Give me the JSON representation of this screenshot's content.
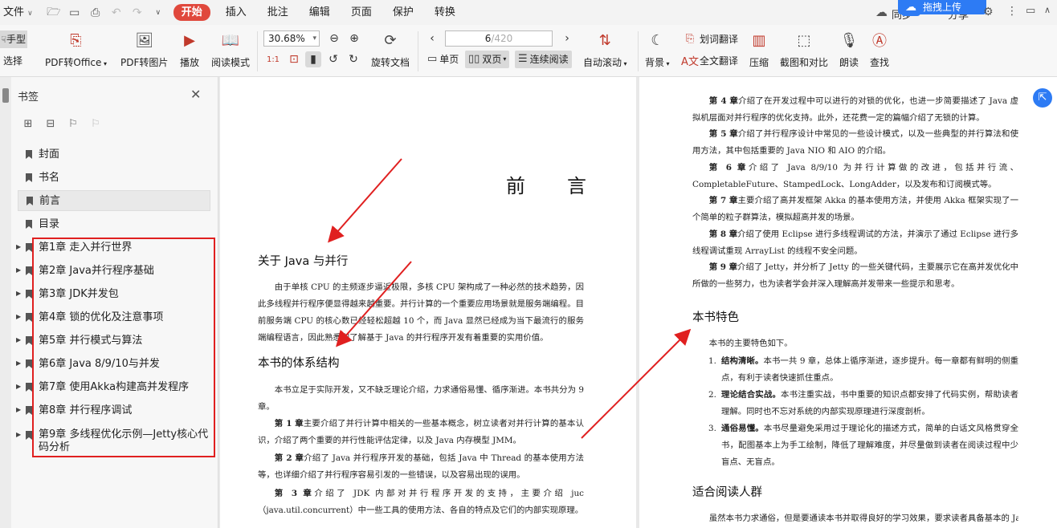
{
  "menubar": {
    "file": "文件",
    "items": [
      "开始",
      "插入",
      "批注",
      "编辑",
      "页面",
      "保护",
      "转换"
    ],
    "sync": "同步",
    "share": "分享",
    "upload": "拖拽上传"
  },
  "ribbon": {
    "hand": "手型",
    "select": "选择",
    "pdf_to_office": "PDF转Office",
    "pdf_to_image": "PDF转图片",
    "play": "播放",
    "read_mode": "阅读模式",
    "zoom": "30.68%",
    "rotate": "旋转文档",
    "page_current": "6",
    "page_total": "/420",
    "single": "单页",
    "double": "双页",
    "continuous": "连续阅读",
    "autoscroll": "自动滚动",
    "background": "背景",
    "word_translate": "划词翻译",
    "full_translate": "全文翻译",
    "compress": "压缩",
    "screenshot_compare": "截图和对比",
    "read_aloud": "朗读",
    "find": "查找"
  },
  "sidebar": {
    "title": "书签",
    "items": [
      "封面",
      "书名",
      "前言",
      "目录",
      "第1章 走入并行世界",
      "第2章 Java并行程序基础",
      "第3章 JDK并发包",
      "第4章 锁的优化及注意事项",
      "第5章 并行模式与算法",
      "第6章 Java 8/9/10与并发",
      "第7章 使用Akka构建高并发程序",
      "第8章 并行程序调试",
      "第9章 多线程优化示例—Jetty核心代码分析"
    ]
  },
  "doc": {
    "left": {
      "heading": "前言",
      "s1_title": "关于 Java 与并行",
      "s1_p": "由于单核 CPU 的主频逐步逼近极限，多核 CPU 架构成了一种必然的技术趋势，因此多线程并行程序便显得越来越重要。并行计算的一个重要应用场景就是服务端编程。目前服务端 CPU 的核心数已经轻松超越 10 个，而 Java 显然已经成为当下最流行的服务端编程语言，因此熟悉和了解基于 Java 的并行程序开发有着重要的实用价值。",
      "s2_title": "本书的体系结构",
      "s2_p": "本书立足于实际开发，又不缺乏理论介绍，力求通俗易懂、循序渐进。本书共分为 9 章。",
      "ch1_label": "第 1 章",
      "ch1": "主要介绍了并行计算中相关的一些基本概念，树立读者对并行计算的基本认识，介绍了两个重要的并行性能评估定律，以及 Java 内存模型 JMM。",
      "ch2_label": "第 2 章",
      "ch2": "介绍了 Java 并行程序开发的基础，包括 Java 中 Thread 的基本使用方法等，也详细介绍了并行程序容易引发的一些错误，以及容易出现的误用。",
      "ch3_label": "第 3 章",
      "ch3": "介绍了 JDK 内部对并行程序开发的支持，主要介绍 juc（java.util.concurrent）中一些工具的使用方法、各自的特点及它们的内部实现原理。"
    },
    "right": {
      "ch4_label": "第 4 章",
      "ch4": "介绍了在开发过程中可以进行的对锁的优化，也进一步简要描述了 Java 虚拟机层面对并行程序的优化支持。此外，还花费一定的篇幅介绍了无锁的计算。",
      "ch5_label": "第 5 章",
      "ch5": "介绍了并行程序设计中常见的一些设计模式，以及一些典型的并行算法和使用方法，其中包括重要的 Java NIO 和 AIO 的介绍。",
      "ch6_label": "第 6 章",
      "ch6": "介绍了 Java 8/9/10 为并行计算做的改进，包括并行流、CompletableFuture、StampedLock、LongAdder，以及发布和订阅模式等。",
      "ch7_label": "第 7 章",
      "ch7": "主要介绍了高并发框架 Akka 的基本使用方法，并使用 Akka 框架实现了一个简单的粒子群算法，模拟超高并发的场景。",
      "ch8_label": "第 8 章",
      "ch8": "介绍了使用 Eclipse 进行多线程调试的方法，并演示了通过 Eclipse 进行多线程调试重现 ArrayList 的线程不安全问题。",
      "ch9_label": "第 9 章",
      "ch9": "介绍了 Jetty，并分析了 Jetty 的一些关键代码，主要展示它在高并发优化中所做的一些努力，也为读者学会并深入理解高并发带来一些提示和思考。",
      "features_title": "本书特色",
      "features_intro": "本书的主要特色如下。",
      "f1_label": "结构清晰。",
      "f1": "本书一共 9 章，总体上循序渐进，逐步提升。每一章都有鲜明的侧重点，有利于读者快速抓住重点。",
      "f2_label": "理论结合实战。",
      "f2": "本书注重实战，书中重要的知识点都安排了代码实例，帮助读者理解。同时也不忘对系统的内部实现原理进行深度剖析。",
      "f3_label": "通俗易懂。",
      "f3": "本书尽量避免采用过于理论化的描述方式，简单的白话文风格贯穿全书，配图基本上为手工绘制，降低了理解难度，并尽量做到读者在阅读过程中少盲点、无盲点。",
      "audience_title": "适合阅读人群",
      "audience_p": "虽然本书力求通俗，但是要通读本书并取得良好的学习效果，要求读者具备基本的 Java"
    }
  },
  "colors": {
    "accent": "#e0483c",
    "annotation": "#e02020",
    "upload": "#2d7bf4"
  }
}
